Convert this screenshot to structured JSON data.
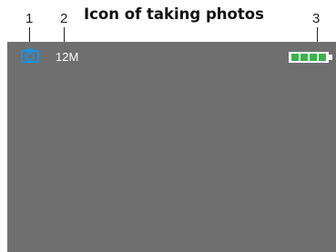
{
  "title": "Icon of taking photos",
  "callouts": [
    {
      "number": "1",
      "target": "camera-mode-icon"
    },
    {
      "number": "2",
      "target": "resolution-label"
    },
    {
      "number": "3",
      "target": "battery-icon"
    }
  ],
  "screen": {
    "resolution": "12M",
    "icons": {
      "mode": "camera-icon",
      "battery": "battery-full-icon"
    },
    "colors": {
      "screen_background": "#6f6f6f",
      "camera_icon": "#1e8fdc",
      "battery_fill": "#39b54a",
      "text": "#ffffff"
    },
    "battery_level": 1.0
  }
}
